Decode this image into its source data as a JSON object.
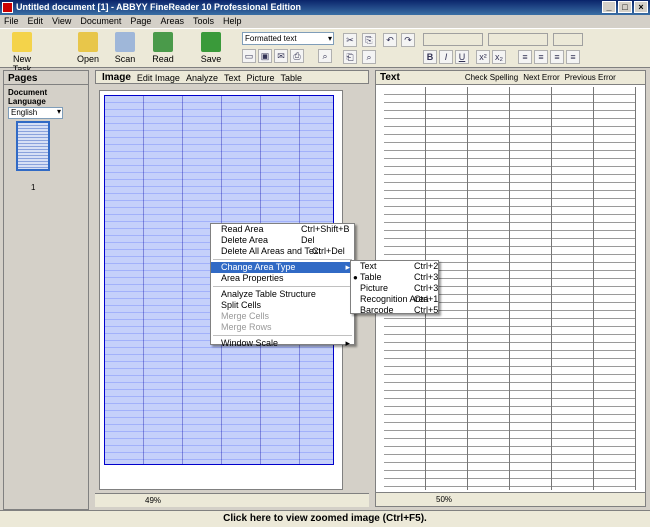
{
  "window": {
    "title": "Untitled document [1] - ABBYY FineReader 10 Professional Edition",
    "controls": [
      "_",
      "□",
      "×"
    ]
  },
  "menu": [
    "File",
    "Edit",
    "View",
    "Document",
    "Page",
    "Areas",
    "Tools",
    "Help"
  ],
  "toolbar": {
    "new_task": "New Task",
    "open": "Open",
    "scan": "Scan",
    "read": "Read",
    "save": "Save",
    "format_value": "Formatted text"
  },
  "pages_pane": {
    "title": "Pages",
    "doc_language_label": "Document Language",
    "language_value": "English",
    "page_number": "1"
  },
  "image_pane": {
    "title": "Image",
    "edit_image": "Edit Image",
    "analyze": "Analyze",
    "text": "Text",
    "picture": "Picture",
    "table": "Table",
    "zoom": "49%"
  },
  "text_pane": {
    "title": "Text",
    "check_spelling": "Check Spelling",
    "next_error": "Next Error",
    "previous_error": "Previous Error",
    "zoom": "50%"
  },
  "context_menu": {
    "items": [
      {
        "label": "Read Area",
        "shortcut": "Ctrl+Shift+B",
        "enabled": true
      },
      {
        "label": "Delete Area",
        "shortcut": "Del",
        "enabled": true
      },
      {
        "label": "Delete All Areas and Text",
        "shortcut": "Ctrl+Del",
        "enabled": true
      },
      {
        "label": "Change Area Type",
        "shortcut": "",
        "enabled": true
      },
      {
        "label": "Area Properties",
        "shortcut": "",
        "enabled": true
      },
      {
        "label": "Analyze Table Structure",
        "shortcut": "",
        "enabled": true
      },
      {
        "label": "Split Cells",
        "shortcut": "",
        "enabled": true
      },
      {
        "label": "Merge Cells",
        "shortcut": "",
        "enabled": false
      },
      {
        "label": "Merge Rows",
        "shortcut": "",
        "enabled": false
      },
      {
        "label": "Window Scale",
        "shortcut": "",
        "enabled": true
      }
    ]
  },
  "submenu": {
    "items": [
      {
        "label": "Text",
        "shortcut": "Ctrl+2"
      },
      {
        "label": "Table",
        "shortcut": "Ctrl+3",
        "checked": true
      },
      {
        "label": "Picture",
        "shortcut": "Ctrl+3"
      },
      {
        "label": "Recognition Area",
        "shortcut": "Ctrl+1"
      },
      {
        "label": "Barcode",
        "shortcut": "Ctrl+5"
      }
    ]
  },
  "status": {
    "text": "Click here to view zoomed image (Ctrl+F5)."
  },
  "colors": {
    "selection": "#316ac5",
    "title_bar": "#0a246a"
  }
}
